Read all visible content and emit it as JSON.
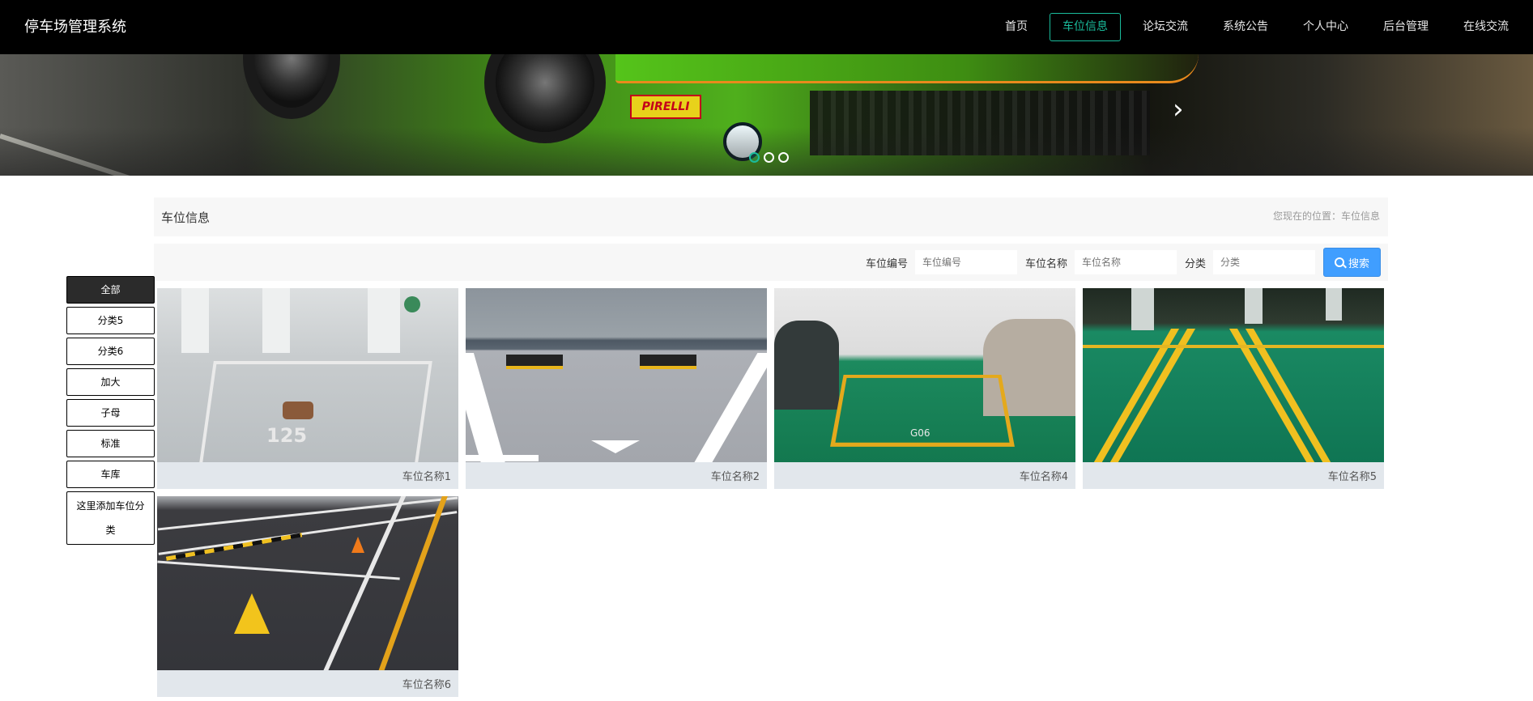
{
  "app": {
    "title": "停车场管理系统"
  },
  "nav": {
    "items": [
      {
        "label": "首页",
        "active": false
      },
      {
        "label": "车位信息",
        "active": true
      },
      {
        "label": "论坛交流",
        "active": false
      },
      {
        "label": "系统公告",
        "active": false
      },
      {
        "label": "个人中心",
        "active": false
      },
      {
        "label": "后台管理",
        "active": false
      },
      {
        "label": "在线交流",
        "active": false
      }
    ]
  },
  "banner": {
    "badge_text": "PIRELLI",
    "slide_count": 3,
    "active_slide": 1
  },
  "breadcrumb": {
    "title": "车位信息",
    "location": "您现在的位置：车位信息"
  },
  "search": {
    "fields": [
      {
        "label": "车位编号",
        "placeholder": "车位编号"
      },
      {
        "label": "车位名称",
        "placeholder": "车位名称"
      },
      {
        "label": "分类",
        "placeholder": "分类"
      }
    ],
    "button_label": "搜索"
  },
  "categories": [
    {
      "label": "全部",
      "active": true
    },
    {
      "label": "分类5",
      "active": false
    },
    {
      "label": "分类6",
      "active": false
    },
    {
      "label": "加大",
      "active": false
    },
    {
      "label": "子母",
      "active": false
    },
    {
      "label": "标准",
      "active": false
    },
    {
      "label": "车库",
      "active": false
    },
    {
      "label": "这里添加车位分类",
      "active": false
    }
  ],
  "spaces": [
    {
      "name": "车位名称1",
      "image": "parking-space-125"
    },
    {
      "name": "车位名称2",
      "image": "parking-space-white-lines"
    },
    {
      "name": "车位名称4",
      "image": "parking-space-g06"
    },
    {
      "name": "车位名称5",
      "image": "parking-garage-green"
    },
    {
      "name": "车位名称6",
      "image": "parking-lot-locks"
    }
  ],
  "colors": {
    "accent": "#1abc9c",
    "button": "#409eff",
    "nav_bg": "#000000"
  }
}
